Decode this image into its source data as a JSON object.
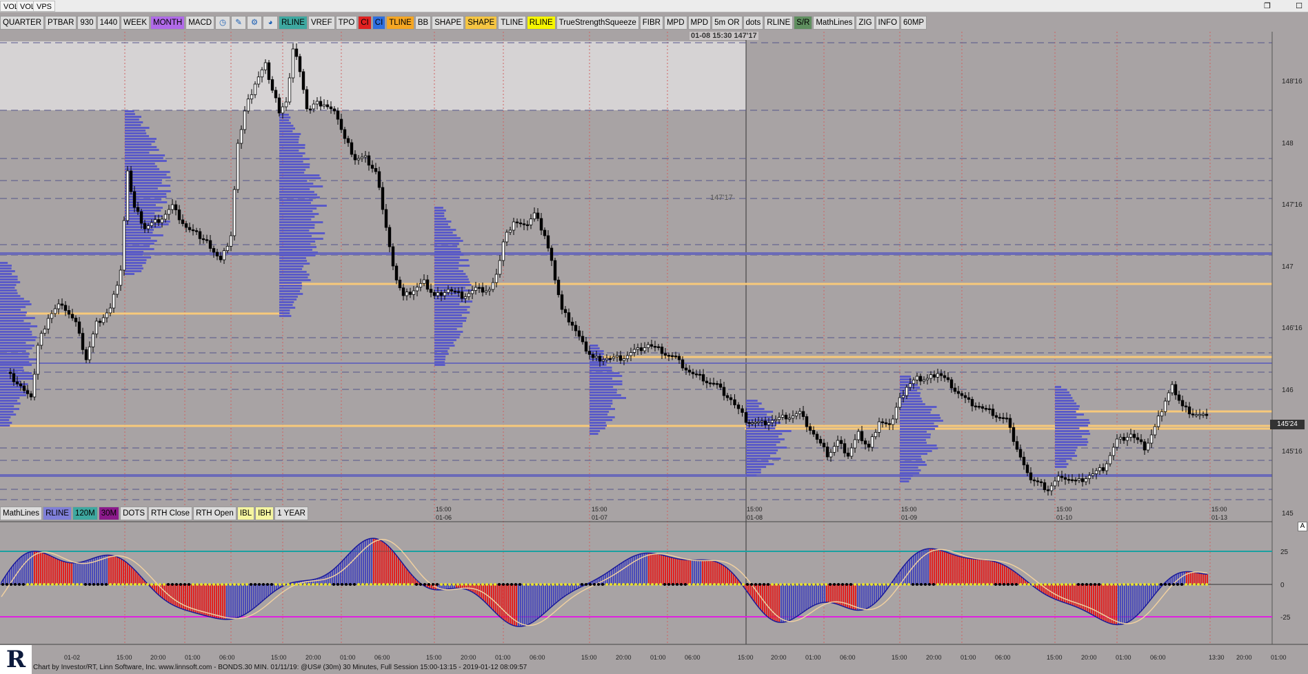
{
  "window": {
    "tabs": [
      "VOL",
      "VOL",
      "VPS"
    ],
    "restore_icon": "restore-window-icon",
    "close_icon": "close-window-icon"
  },
  "toolbar": {
    "buttons": [
      {
        "label": "QUARTER",
        "bg": "#dcdcdc",
        "fg": "#000000"
      },
      {
        "label": "PTBAR",
        "bg": "#dcdcdc",
        "fg": "#000000"
      },
      {
        "label": "930",
        "bg": "#dcdcdc",
        "fg": "#000000"
      },
      {
        "label": "1440",
        "bg": "#dcdcdc",
        "fg": "#000000"
      },
      {
        "label": "WEEK",
        "bg": "#dcdcdc",
        "fg": "#000000"
      },
      {
        "label": "MONTH",
        "bg": "#b06ae8",
        "fg": "#000000"
      },
      {
        "label": "MACD",
        "bg": "#dcdcdc",
        "fg": "#000000"
      },
      {
        "icon": "clock-icon"
      },
      {
        "icon": "pencil-icon"
      },
      {
        "icon": "gear-icon"
      },
      {
        "icon": "globe-icon"
      },
      {
        "label": "RLINE",
        "bg": "#3ea8a0",
        "fg": "#000000"
      },
      {
        "label": "VREF",
        "bg": "#dcdcdc",
        "fg": "#000000"
      },
      {
        "label": "TPO",
        "bg": "#dcdcdc",
        "fg": "#000000"
      },
      {
        "label": "CI",
        "bg": "#e02020",
        "fg": "#000000"
      },
      {
        "label": "CI",
        "bg": "#2e6fe0",
        "fg": "#000000"
      },
      {
        "label": "TLINE",
        "bg": "#f5a623",
        "fg": "#000000"
      },
      {
        "label": "BB",
        "bg": "#dcdcdc",
        "fg": "#000000"
      },
      {
        "label": "SHAPE",
        "bg": "#dcdcdc",
        "fg": "#000000"
      },
      {
        "label": "SHAPE",
        "bg": "#f5c542",
        "fg": "#000000"
      },
      {
        "label": "TLINE",
        "bg": "#dcdcdc",
        "fg": "#000000"
      },
      {
        "label": "RLINE",
        "bg": "#f5f500",
        "fg": "#000000"
      },
      {
        "label": "TrueStrengthSqueeze",
        "bg": "#dcdcdc",
        "fg": "#000000"
      },
      {
        "label": "FIBR",
        "bg": "#dcdcdc",
        "fg": "#000000"
      },
      {
        "label": "MPD",
        "bg": "#dcdcdc",
        "fg": "#000000"
      },
      {
        "label": "MPD",
        "bg": "#dcdcdc",
        "fg": "#000000"
      },
      {
        "label": "5m OR",
        "bg": "#dcdcdc",
        "fg": "#000000"
      },
      {
        "label": "dots",
        "bg": "#dcdcdc",
        "fg": "#000000"
      },
      {
        "label": "RLINE",
        "bg": "#dcdcdc",
        "fg": "#000000"
      },
      {
        "label": "S/R",
        "bg": "#5f8f5f",
        "fg": "#000000"
      },
      {
        "label": "MathLines",
        "bg": "#dcdcdc",
        "fg": "#000000"
      },
      {
        "label": "ZIG",
        "bg": "#dcdcdc",
        "fg": "#000000"
      },
      {
        "label": "INFO",
        "bg": "#dcdcdc",
        "fg": "#000000"
      },
      {
        "label": "60MP",
        "bg": "#dcdcdc",
        "fg": "#000000"
      }
    ]
  },
  "toolbar2": {
    "buttons": [
      {
        "label": "MathLines",
        "bg": "#dcdcdc",
        "fg": "#000000"
      },
      {
        "label": "RLINE",
        "bg": "#7f7fd8",
        "fg": "#000000"
      },
      {
        "label": "120M",
        "bg": "#3ea8a0",
        "fg": "#000000"
      },
      {
        "label": "30M",
        "bg": "#8b1a8b",
        "fg": "#000000"
      },
      {
        "label": "DOTS",
        "bg": "#dcdcdc",
        "fg": "#000000"
      },
      {
        "label": "RTH Close",
        "bg": "#dcdcdc",
        "fg": "#000000"
      },
      {
        "label": "RTH Open",
        "bg": "#dcdcdc",
        "fg": "#000000"
      },
      {
        "label": "IBL",
        "bg": "#f5f5a0",
        "fg": "#000000"
      },
      {
        "label": "IBH",
        "bg": "#f5f5a0",
        "fg": "#000000"
      },
      {
        "label": "1 YEAR",
        "bg": "#dcdcdc",
        "fg": "#000000"
      }
    ]
  },
  "crosshair_label": "01-08 15:30  147'17",
  "price_axis": {
    "labels": [
      "148'16",
      "148",
      "147'16",
      "147",
      "146'16",
      "146",
      "145'16",
      "145"
    ],
    "current_price": "145'24",
    "annotation": "147'17"
  },
  "indicator_axis": {
    "labels": [
      "25",
      "0",
      "-25"
    ],
    "scale_button": "A"
  },
  "session_labels": [
    {
      "time": "15:00",
      "date": "01-06"
    },
    {
      "time": "15:00",
      "date": "01-07"
    },
    {
      "time": "15:00",
      "date": "01-08"
    },
    {
      "time": "15:00",
      "date": "01-09"
    },
    {
      "time": "15:00",
      "date": "01-10"
    },
    {
      "time": "15:00",
      "date": "01-13"
    }
  ],
  "time_axis": {
    "labels": [
      "01-02",
      "15:00",
      "20:00",
      "01:00",
      "06:00",
      "15:00",
      "20:00",
      "01:00",
      "06:00",
      "15:00",
      "20:00",
      "01:00",
      "06:00",
      "15:00",
      "20:00",
      "01:00",
      "06:00",
      "15:00",
      "20:00",
      "01:00",
      "06:00",
      "15:00",
      "20:00",
      "01:00",
      "06:00",
      "15:00",
      "20:00",
      "01:00",
      "06:00",
      "13:30",
      "20:00",
      "01:00"
    ]
  },
  "status_bar": "Chart by Investor/RT, Linn Software, Inc. www.linnsoft.com - BONDS.30 MIN.   01/11/19: @US# (30m) 30 Minutes, Full Session 15:00-13:15 - 2019-01-12 08:09:57",
  "logo_text": "R",
  "colors": {
    "background": "#a8a3a4",
    "profile": "#5a5ac8",
    "poc": "#f7c97a",
    "rline": "#6a6ab8",
    "bull_hist": "#4a4ab8",
    "bear_hist": "#e02020",
    "macd_fast": "#1a1a9a",
    "macd_slow": "#f0d0a0",
    "upper_band": "#1aa0a0",
    "lower_band": "#e020e0"
  }
}
